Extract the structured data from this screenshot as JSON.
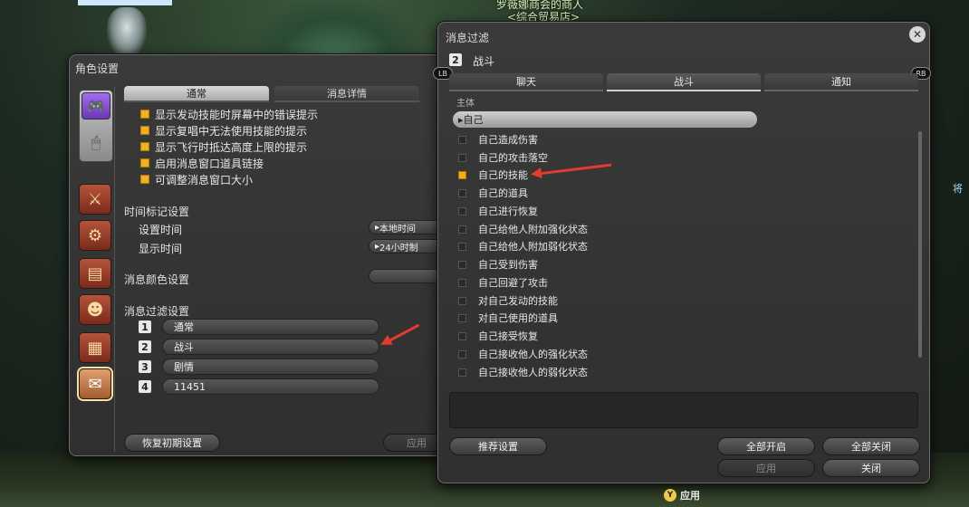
{
  "background": {
    "npc_title": "罗薇娜商会的商人",
    "npc_subtitle": "<综合贸易店>",
    "right_label": "将"
  },
  "character_settings": {
    "title": "角色设置",
    "tabs": [
      "通常",
      "消息详情"
    ],
    "checkboxes": [
      {
        "label": "显示发动技能时屏幕中的错误提示",
        "checked": true
      },
      {
        "label": "显示复唱中无法使用技能的提示",
        "checked": true
      },
      {
        "label": "显示飞行时抵达高度上限的提示",
        "checked": true
      },
      {
        "label": "启用消息窗口道具链接",
        "checked": true
      },
      {
        "label": "可调整消息窗口大小",
        "checked": true
      }
    ],
    "timestamp_section": "时间标记设置",
    "set_time_label": "设置时间",
    "set_time_value": "本地时间",
    "display_time_label": "显示时间",
    "display_time_value": "24小时制",
    "color_section": "消息颜色设置",
    "filter_section": "消息过滤设置",
    "filters": [
      {
        "num": "1",
        "name": "通常"
      },
      {
        "num": "2",
        "name": "战斗"
      },
      {
        "num": "3",
        "name": "剧情"
      },
      {
        "num": "4",
        "name": "11451"
      }
    ],
    "reset_button": "恢复初期设置",
    "apply_button": "应用"
  },
  "message_filter": {
    "title": "消息过滤",
    "filter_num": "2",
    "filter_name": "战斗",
    "lb": "LB",
    "rb": "RB",
    "tabs": [
      "聊天",
      "战斗",
      "通知"
    ],
    "active_tab": "战斗",
    "subject_label": "主体",
    "subject_value": "自己",
    "items": [
      {
        "label": "自己造成伤害",
        "checked": false
      },
      {
        "label": "自己的攻击落空",
        "checked": false
      },
      {
        "label": "自己的技能",
        "checked": true
      },
      {
        "label": "自己的道具",
        "checked": false
      },
      {
        "label": "自己进行恢复",
        "checked": false
      },
      {
        "label": "自己给他人附加强化状态",
        "checked": false
      },
      {
        "label": "自己给他人附加弱化状态",
        "checked": false
      },
      {
        "label": "自己受到伤害",
        "checked": false
      },
      {
        "label": "自己回避了攻击",
        "checked": false
      },
      {
        "label": "对自己发动的技能",
        "checked": false
      },
      {
        "label": "对自己使用的道具",
        "checked": false
      },
      {
        "label": "自己接受恢复",
        "checked": false
      },
      {
        "label": "自己接收他人的强化状态",
        "checked": false
      },
      {
        "label": "自己接收他人的弱化状态",
        "checked": false
      }
    ],
    "recommend_button": "推荐设置",
    "enable_all_button": "全部开启",
    "disable_all_button": "全部关闭",
    "apply_button": "应用",
    "close_button": "关闭"
  },
  "bottom_hint": {
    "button": "Y",
    "label": "应用"
  },
  "colors": {
    "checkbox_on": "#f0b020",
    "annotation_arrow": "#e43b2f"
  }
}
